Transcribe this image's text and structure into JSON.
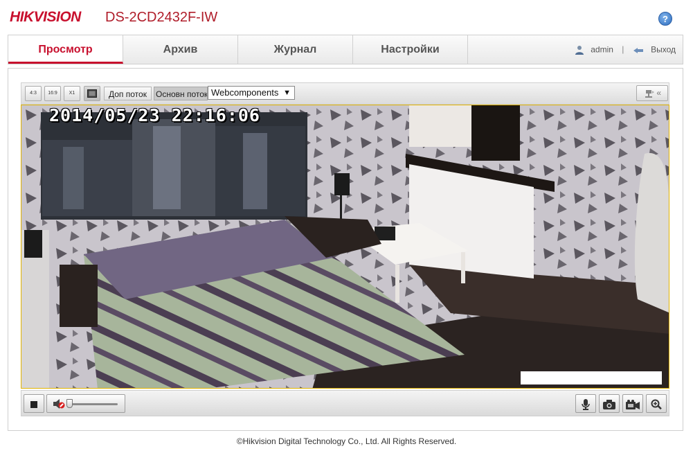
{
  "header": {
    "logo": "HIKVISION",
    "model": "DS-2CD2432F-IW",
    "help_label": "?"
  },
  "nav": {
    "tabs": [
      {
        "label": "Просмотр",
        "active": true
      },
      {
        "label": "Архив",
        "active": false
      },
      {
        "label": "Журнал",
        "active": false
      },
      {
        "label": "Настройки",
        "active": false
      }
    ],
    "user": "admin",
    "separator": "|",
    "logout": "Выход"
  },
  "toolbar": {
    "aspect_buttons": [
      "4:3",
      "16:9",
      "X1",
      "full"
    ],
    "sub_stream": "Доп поток",
    "main_stream": "Основн поток",
    "plugin_select": "Webcomponents",
    "collapse_label": "«"
  },
  "video": {
    "osd_timestamp": "2014/05/23 22:16:06"
  },
  "footer": {
    "copyright": "©Hikvision Digital Technology Co., Ltd. All Rights Reserved."
  },
  "colors": {
    "brand": "#c8102e",
    "video_border": "#e2b400"
  },
  "icons": {
    "help": "help-icon",
    "user": "user-icon",
    "logout": "logout-icon",
    "stop": "stop-icon",
    "mute": "speaker-muted-icon",
    "mic": "microphone-icon",
    "snapshot": "camera-icon",
    "record": "video-record-icon",
    "zoom": "zoom-icon"
  }
}
